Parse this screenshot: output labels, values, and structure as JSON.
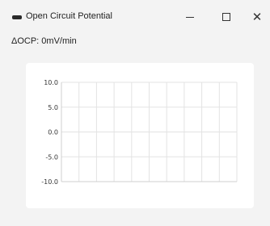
{
  "window": {
    "title": "Open Circuit Potential",
    "controls": {
      "minimize_icon": "minimize-icon",
      "maximize_icon": "maximize-icon",
      "close_icon": "close-icon",
      "close_glyph": "✕"
    }
  },
  "ocp": {
    "label": "ΔOCP: 0mV/min"
  },
  "chart_data": {
    "type": "line",
    "title": "",
    "xlabel": "",
    "ylabel": "",
    "yticks": [
      "10.0",
      "5.0",
      "0.0",
      "-5.0",
      "-10.0"
    ],
    "ylim": [
      -10,
      10
    ],
    "x_gridlines": 10,
    "series": [],
    "grid": true,
    "grid_color": "#e3e3e3"
  }
}
